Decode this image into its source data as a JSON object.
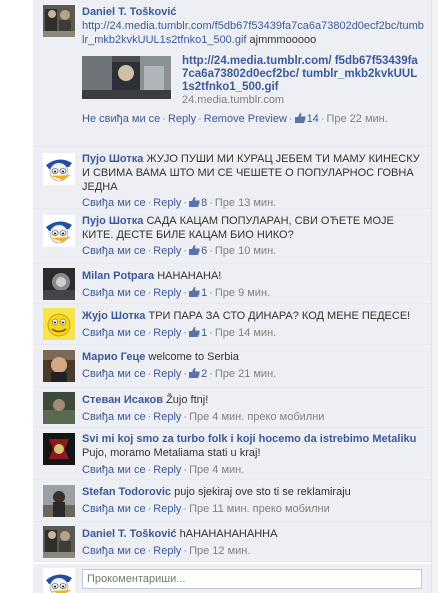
{
  "comments": [
    {
      "author": "Daniel T. Tošković",
      "url": "http://24.media.tumblr.com/f5db67f53439fa7ca6a73802d0ecf2bc/tumblr_mkb2kvkUUL1s2tfnko1_500.gif",
      "text": "ajmmmooooo",
      "share": {
        "title": "http://24.media.tumblr.com/ f5db67f53439fa7ca6a73802d0ecf2bc/ tumblr_mkb2kvkUUL1s2tfnko1_500.gif",
        "domain": "24.media.tumblr.com"
      },
      "like_label": "Не свиђа ми се",
      "reply_label": "Reply",
      "remove_preview_label": "Remove Preview",
      "likes": "14",
      "time": "Пре 22 мин."
    },
    {
      "author": "Пујо Шотка",
      "text": "ЖУЈО ПУШИ МИ КУРАЦ ЈЕБЕМ ТИ МАМУ КИНЕСКУ И СВИМА ВАМА ШТО МИ СЕ ЧЕШЕТЕ О ПОПУЛАРНОС ГОВНА ЈЕДНА",
      "like_label": "Свиђа ми се",
      "reply_label": "Reply",
      "likes": "8",
      "time": "Пре 13 мин."
    },
    {
      "author": "Пујо Шотка",
      "text": "САДА КАЦАМ ПОПУЛАРАН, СВИ ОЋЕТЕ МОЈЕ КИТЕ. ДЕСТЕ БИЛЕ КАЦАМ БИО НИКО?",
      "like_label": "Свиђа ми се",
      "reply_label": "Reply",
      "likes": "6",
      "time": "Пре 10 мин."
    },
    {
      "author": "Milan Potpara",
      "text": "HAHAHAHA!",
      "like_label": "Свиђа ми се",
      "reply_label": "Reply",
      "likes": "1",
      "time": "Пре 9 мин."
    },
    {
      "author": "Жујо Шотка",
      "text": "ТРИ ПАРА ЗА СТО ДИНАРА? КОД МЕНЕ ПЕДЕСЕ!",
      "like_label": "Свиђа ми се",
      "reply_label": "Reply",
      "likes": "1",
      "time": "Пре 14 мин."
    },
    {
      "author": "Марио Геце",
      "text": "welcome to Serbia",
      "like_label": "Свиђа ми се",
      "reply_label": "Reply",
      "likes": "2",
      "time": "Пре 21 мин."
    },
    {
      "author": "Стеван Исаков",
      "text": "Žujo ftnj!",
      "like_label": "Свиђа ми се",
      "reply_label": "Reply",
      "time": "Пре 4 мин. преко мобилни"
    },
    {
      "author": "Svi mi koj smo za turbo folk i koji hocemo da istrebimo Metaliku",
      "text": "Pujo, moramo Metaliama stati u kraj!",
      "like_label": "Свиђа ми се",
      "reply_label": "Reply",
      "time": "Пре 4 мин."
    },
    {
      "author": "Stefan Todorovic",
      "text": "pujo sjekiraj ove sto ti se reklamiraju",
      "like_label": "Свиђа ми се",
      "reply_label": "Reply",
      "time": "Пре 11 мин. преко мобилни"
    },
    {
      "author": "Daniel T. Tošković",
      "text": "hAHAHAHAHAHHA",
      "like_label": "Свиђа ми се",
      "reply_label": "Reply",
      "time": "Пре 12 мин."
    }
  ],
  "composer": {
    "placeholder": "Прокоментариши..."
  },
  "icons": {
    "like": "thumbs-up-icon"
  },
  "colors": {
    "link": "#3b5998",
    "thread_bg": "#edeff4",
    "meta": "#808080"
  }
}
